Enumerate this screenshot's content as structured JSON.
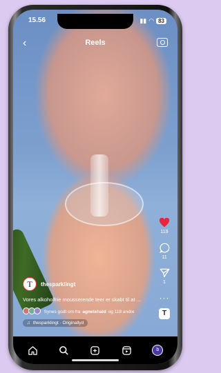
{
  "status_bar": {
    "time": "15.56",
    "battery": "83"
  },
  "header": {
    "title": "Reels"
  },
  "actions": {
    "likes": "119",
    "comments": "11",
    "shares": "1",
    "more": "···"
  },
  "post": {
    "username": "thesparklingt",
    "avatar_letter": "T",
    "caption": "Vores alkoholfrie mousserende teer er skabt til at ...",
    "liked_by_prefix": "Synes godt om fra",
    "liked_by_user": "agnetehald",
    "liked_by_suffix": "og 118 andre",
    "audio": "thesparklingt · Originallyd"
  },
  "nav": {
    "profile_letter": "b"
  },
  "colors": {
    "like": "#e8253f",
    "nav_bg": "#000000"
  }
}
